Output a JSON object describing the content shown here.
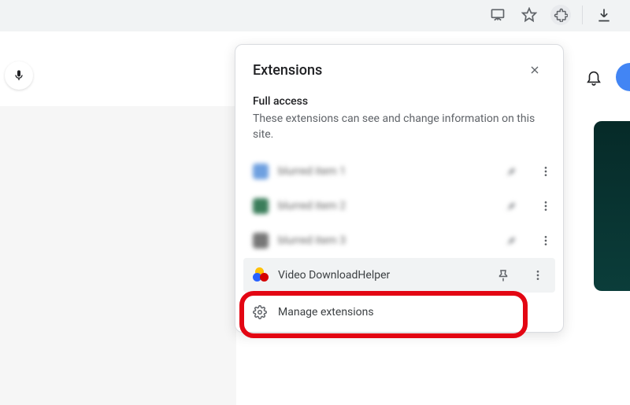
{
  "popup": {
    "title": "Extensions",
    "section_title": "Full access",
    "section_desc": "These extensions can see and change information on this site.",
    "items": [
      {
        "name": "blurred item 1",
        "blurred": true
      },
      {
        "name": "blurred item 2",
        "blurred": true
      },
      {
        "name": "blurred item 3",
        "blurred": true
      },
      {
        "name": "Video DownloadHelper",
        "blurred": false,
        "highlight": true
      }
    ],
    "manage_label": "Manage extensions"
  }
}
